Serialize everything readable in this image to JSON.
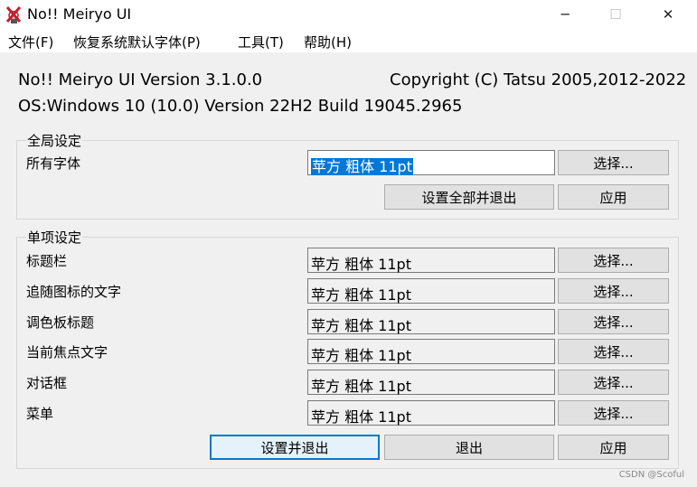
{
  "window": {
    "title": "No!! Meiryo UI",
    "minimize": "─",
    "maximize": "☐",
    "close": "✕"
  },
  "menu": [
    "文件(F)",
    "恢复系统默认字体(P)",
    "工具(T)",
    "帮助(H)"
  ],
  "info": {
    "version": "No!! Meiryo UI Version 3.1.0.0",
    "copyright": "Copyright (C) Tatsu 2005,2012-2022",
    "os": "OS:Windows 10 (10.0) Version 22H2 Build 19045.2965"
  },
  "global": {
    "title": "全局设定",
    "label": "所有字体",
    "font_value": "苹方 粗体  11pt",
    "select_label": "选择...",
    "set_all_exit": "设置全部并退出",
    "apply": "应用"
  },
  "single": {
    "title": "单项设定",
    "rows": [
      {
        "label": "标题栏",
        "value": "苹方 粗体  11pt",
        "select": "选择..."
      },
      {
        "label": "追随图标的文字",
        "value": "苹方 粗体  11pt",
        "select": "选择..."
      },
      {
        "label": "调色板标题",
        "value": "苹方 粗体  11pt",
        "select": "选择..."
      },
      {
        "label": "当前焦点文字",
        "value": "苹方 粗体  11pt",
        "select": "选择..."
      },
      {
        "label": "对话框",
        "value": "苹方 粗体  11pt",
        "select": "选择..."
      },
      {
        "label": "菜单",
        "value": "苹方 粗体  11pt",
        "select": "选择..."
      }
    ],
    "set_exit": "设置并退出",
    "exit": "退出",
    "apply": "应用"
  },
  "watermark": "CSDN @Scoful",
  "colors": {
    "selection": "#0078d7",
    "default_button_border": "#0078d7"
  },
  "icons": {
    "app": "app-logo-icon"
  }
}
